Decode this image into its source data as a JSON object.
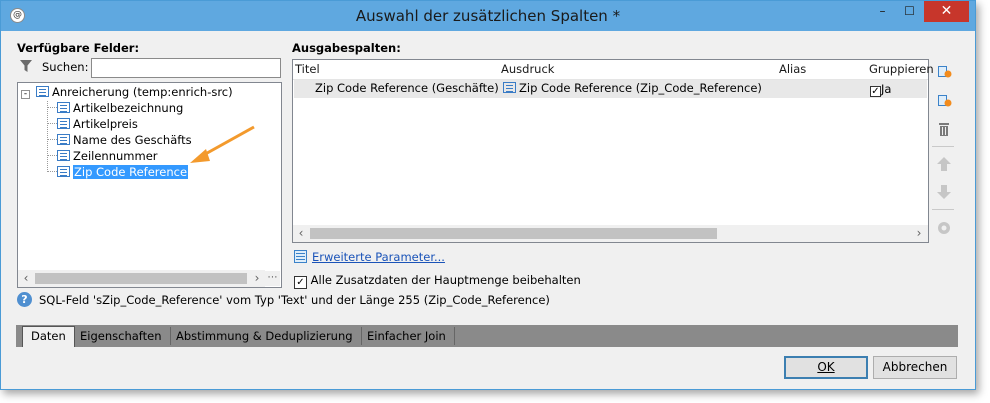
{
  "window": {
    "title": "Auswahl der zusätzlichen Spalten *",
    "minimize": "–",
    "maximize": "☐",
    "close": "✕"
  },
  "left": {
    "label": "Verfügbare Felder:",
    "search_label": "Suchen:",
    "search_value": "",
    "tree": {
      "root": "Anreicherung (temp:enrich-src)",
      "items": [
        "Artikelbezeichnung",
        "Artikelpreis",
        "Name des Geschäfts",
        "Zeilennummer",
        "Zip Code Reference"
      ],
      "selected_index": 4
    }
  },
  "right": {
    "label": "Ausgabespalten:",
    "columns": [
      "Titel",
      "Ausdruck",
      "Alias",
      "Gruppieren"
    ],
    "rows": [
      {
        "titel": "Zip Code Reference (Geschäfte)",
        "ausdruck": "Zip Code Reference (Zip_Code_Reference)",
        "alias": "",
        "gruppieren": "Ja",
        "gruppieren_checked": true
      }
    ],
    "advanced_link": "Erweiterte Parameter...",
    "keep_data_label": "Alle Zusatzdaten der Hauptmenge beibehalten",
    "keep_data_checked": true
  },
  "info": "SQL-Feld 'sZip_Code_Reference' vom Typ 'Text' und der Länge 255 (Zip_Code_Reference)",
  "tabs": [
    "Daten",
    "Eigenschaften",
    "Abstimmung & Deduplizierung",
    "Einfacher Join"
  ],
  "active_tab": 0,
  "buttons": {
    "ok": "OK",
    "cancel": "Abbrechen"
  },
  "colors": {
    "titlebar": "#5fa8e0",
    "close": "#c7362b",
    "selection": "#3399ff",
    "annotation_arrow": "#f39a2d",
    "link": "#1a53b8"
  }
}
